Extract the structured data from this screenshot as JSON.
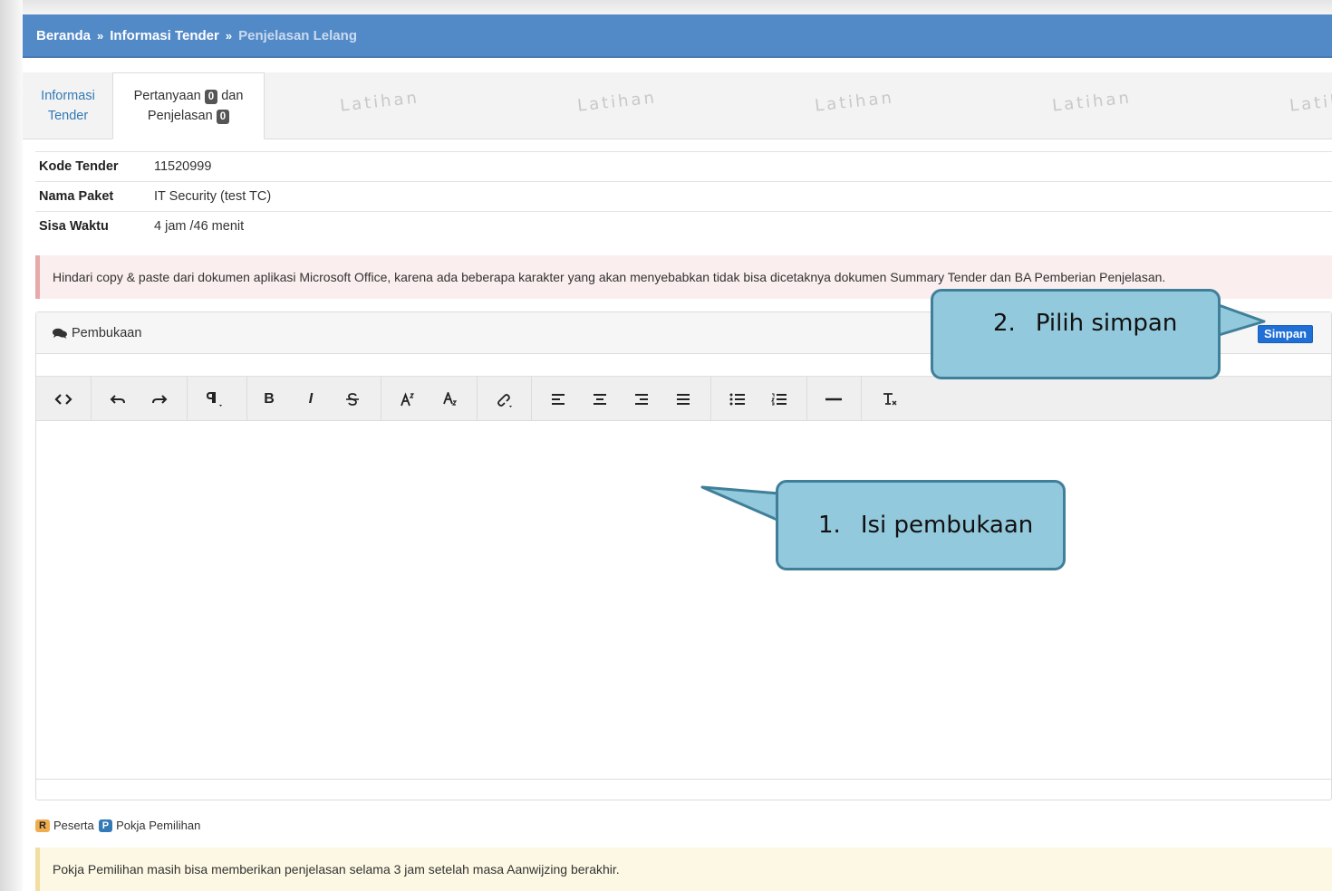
{
  "breadcrumb": {
    "home": "Beranda",
    "separator": "»",
    "info_tender": "Informasi Tender",
    "current": "Penjelasan Lelang"
  },
  "tabs": {
    "info": {
      "line1": "Informasi",
      "line2": "Tender"
    },
    "pertanyaan": {
      "label_a": "Pertanyaan",
      "count_a": "0",
      "label_b": "dan",
      "label_c": "Penjelasan",
      "count_c": "0"
    }
  },
  "watermark_text": "Latihan",
  "tender_info": {
    "rows": [
      {
        "label": "Kode Tender",
        "value": "11520999"
      },
      {
        "label": "Nama Paket",
        "value": "IT Security (test TC)"
      },
      {
        "label": "Sisa Waktu",
        "value": "4 jam /46 menit"
      }
    ]
  },
  "alert_office": "Hindari copy & paste dari dokumen aplikasi Microsoft Office, karena ada beberapa karakter yang akan menyebabkan tidak bisa dicetaknya dokumen Summary Tender dan BA Pemberian Penjelasan.",
  "panel": {
    "title": "Pembukaan",
    "save_label": "Simpan"
  },
  "toolbar": {
    "items": [
      "code-view",
      "undo",
      "redo",
      "paragraph-style",
      "bold",
      "italic",
      "strikethrough",
      "superscript",
      "subscript",
      "link",
      "align-left",
      "align-center",
      "align-right",
      "align-justify",
      "unordered-list",
      "ordered-list",
      "horizontal-rule",
      "clear-format"
    ],
    "bold_label": "B",
    "italic_label": "I"
  },
  "legend": {
    "r_badge": "R",
    "r_label": "Peserta",
    "p_badge": "P",
    "p_label": "Pokja Pemilihan"
  },
  "alert_pokja": "Pokja Pemilihan masih bisa memberikan penjelasan selama 3 jam setelah masa Aanwijzing berakhir.",
  "callouts": {
    "first": {
      "number": "1.",
      "text": "Isi pembukaan"
    },
    "second": {
      "number": "2.",
      "text": "Pilih simpan"
    }
  },
  "colors": {
    "topbar": "#5289c7",
    "save_button": "#1f6fd6",
    "callout_fill": "#93c9dc",
    "callout_border": "#3f7f99"
  }
}
